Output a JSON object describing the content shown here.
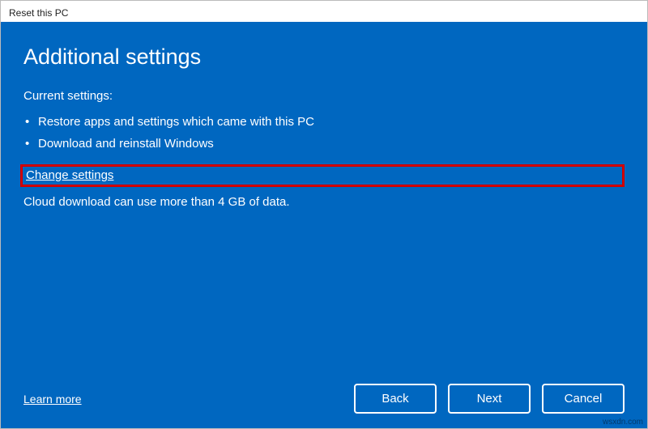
{
  "window": {
    "title": "Reset this PC"
  },
  "page": {
    "heading": "Additional settings",
    "current_label": "Current settings:",
    "bullets": [
      "Restore apps and settings which came with this PC",
      "Download and reinstall Windows"
    ],
    "change_link": "Change settings",
    "note": "Cloud download can use more than 4 GB of data."
  },
  "footer": {
    "learn_more": "Learn more",
    "back": "Back",
    "next": "Next",
    "cancel": "Cancel"
  },
  "watermark": "wsxdn.com"
}
